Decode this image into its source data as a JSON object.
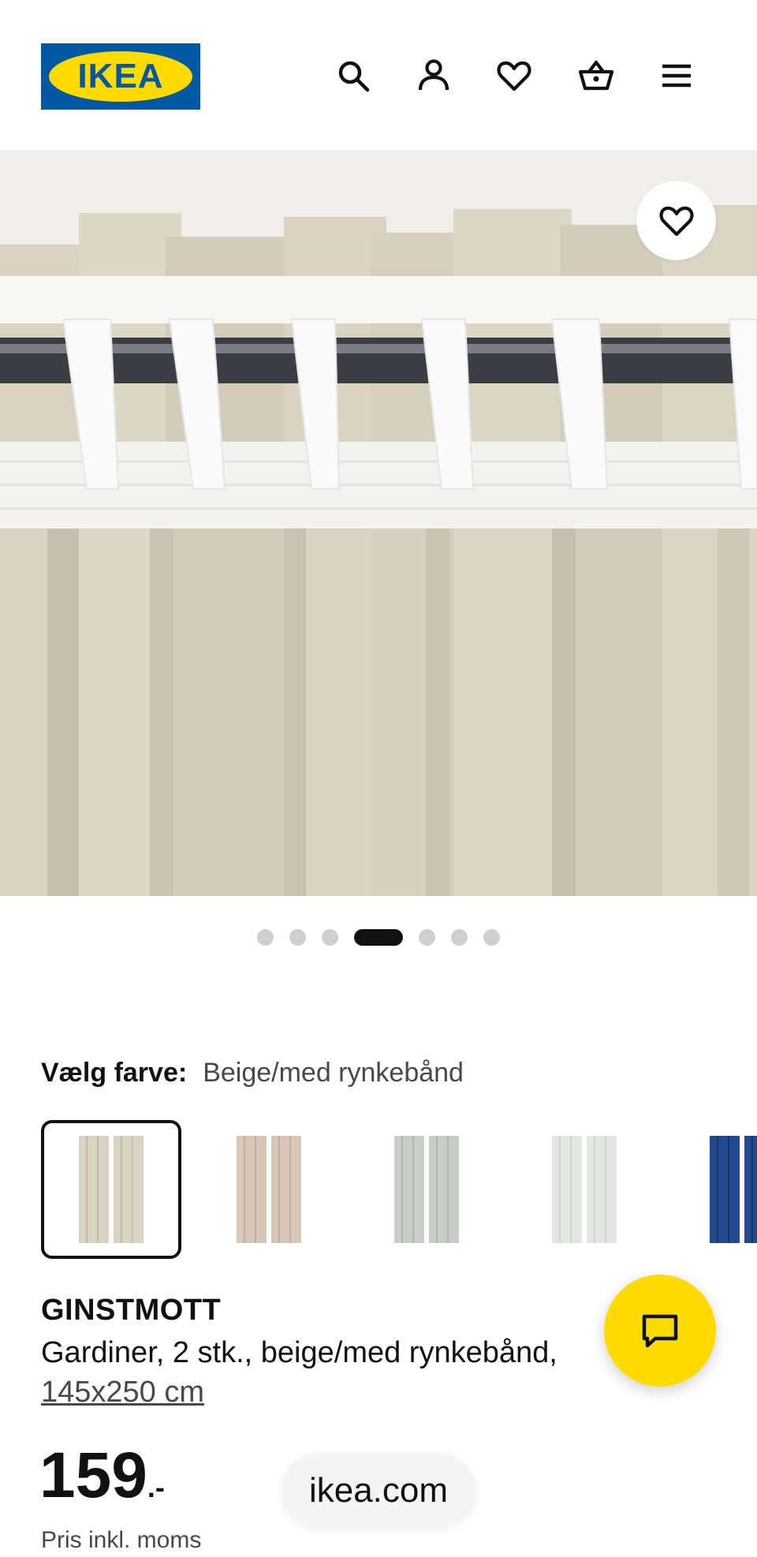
{
  "header": {
    "logo_text": "IKEA",
    "icons": [
      "search-icon",
      "user-icon",
      "heart-icon",
      "basket-icon",
      "menu-icon"
    ]
  },
  "gallery": {
    "favorite_icon": "heart-icon",
    "dots_total": 7,
    "active_dot": 4
  },
  "color_chooser": {
    "label": "Vælg farve:",
    "selected_value": "Beige/med rynkebånd",
    "swatch_colors": [
      "#d9d3c3",
      "#d8c6b8",
      "#c9cdc8",
      "#e4e6e3",
      "#234a8f"
    ]
  },
  "product": {
    "name": "GINSTMOTT",
    "description": "Gardiner, 2 stk., beige/med rynkebånd,",
    "size": "145x250 cm",
    "price_main": "159",
    "price_suffix": ".-",
    "price_note": "Pris inkl. moms"
  },
  "chat": {
    "icon": "chat-icon"
  },
  "browser": {
    "url": "ikea.com"
  },
  "colors": {
    "brand_blue": "#0058a3",
    "brand_yellow": "#ffdb00"
  }
}
